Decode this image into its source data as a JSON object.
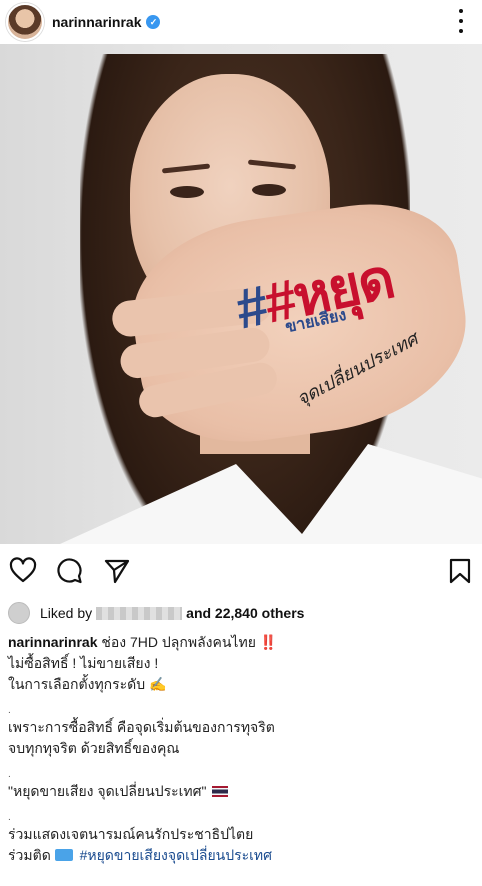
{
  "header": {
    "username": "narinnarinrak",
    "verified_icon": "verified-badge-icon",
    "more_icon": "more-options-icon"
  },
  "photo": {
    "hand_hashtag": "#หยุด",
    "hand_subtext": "ขายเสียง",
    "hand_script": "จุดเปลี่ยนประเทศ"
  },
  "actions": {
    "like_icon": "heart-icon",
    "comment_icon": "comment-icon",
    "share_icon": "send-icon",
    "save_icon": "bookmark-icon"
  },
  "likes": {
    "prefix": "Liked by",
    "suffix": "and 22,840 others"
  },
  "caption": {
    "username": "narinnarinrak",
    "line1": "ช่อง 7HD  ปลุกพลังคนไทย",
    "line1_bangs": "‼️",
    "line2": "ไม่ซื้อสิทธิ์ ! ไม่ขายเสียง !",
    "line3": "ในการเลือกตั้งทุกระดับ",
    "dot": ".",
    "line4": "เพราะการซื้อสิทธิ์ คือจุดเริ่มต้นของการทุจริต",
    "line5": "จบทุกทุจริต ด้วยสิทธิ์ของคุณ",
    "line6": "\"หยุดขายเสียง จุดเปลี่ยนประเทศ\"",
    "line7": "ร่วมแสดงเจตนารมณ์คนรักประชาธิปไตย",
    "line8_prefix": "ร่วมติด",
    "line8_hashtag": "#หยุดขายเสียงจุดเปลี่ยนประเทศ"
  }
}
